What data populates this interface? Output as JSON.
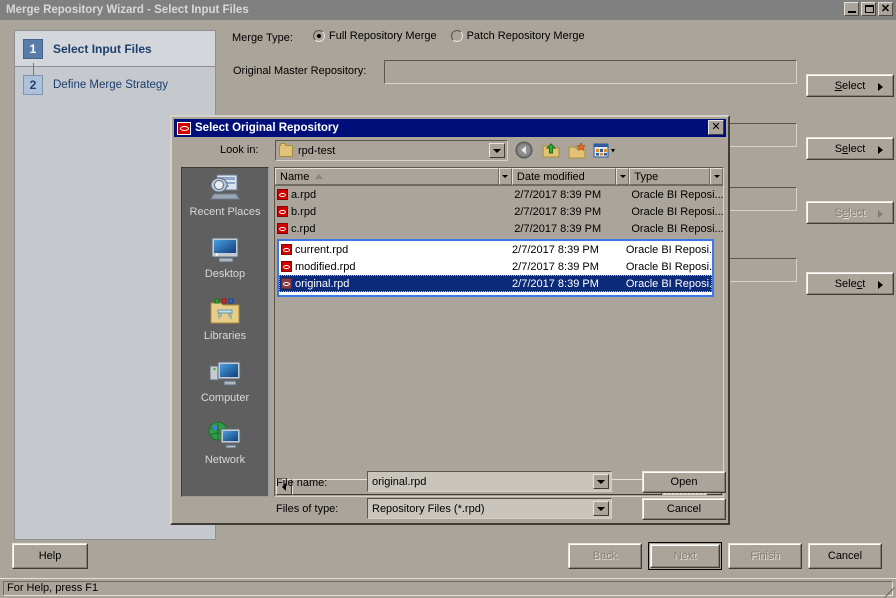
{
  "window": {
    "title": "Merge Repository Wizard - Select Input Files",
    "minimize_label": "Minimize",
    "maximize_label": "Maximize",
    "close_label": "✕"
  },
  "steps": [
    {
      "number": "1",
      "label": "Select Input Files"
    },
    {
      "number": "2",
      "label": "Define Merge Strategy"
    }
  ],
  "form": {
    "merge_type_label": "Merge Type:",
    "radio_full": "Full Repository Merge",
    "radio_patch": "Patch Repository Merge",
    "original_master_label": "Original Master Repository:",
    "original_master_value": "",
    "select_buttons": [
      {
        "prefix": "S",
        "mnemonic": "",
        "rest": "elect",
        "label": "Select",
        "mnemonic_char": "S",
        "disabled": false
      },
      {
        "label": "Select",
        "mnemonic_char": "e",
        "disabled": false
      },
      {
        "label": "Select",
        "mnemonic_char": "e",
        "disabled": true
      },
      {
        "label": "Select",
        "mnemonic_char": "c",
        "disabled": false
      }
    ]
  },
  "footer": {
    "help": "Help",
    "back": "Back",
    "next": "Next",
    "finish": "Finish",
    "cancel": "Cancel"
  },
  "statusbar": {
    "text": "For Help, press F1"
  },
  "dialog": {
    "title": "Select Original Repository",
    "close_label": "✕",
    "look_in_label": "Look in:",
    "look_in_value": "rpd-test",
    "toolbar": [
      {
        "name": "back-nav-icon",
        "title": "Back"
      },
      {
        "name": "up-one-level-icon",
        "title": "Up One Level"
      },
      {
        "name": "new-folder-icon",
        "title": "Create New Folder"
      },
      {
        "name": "views-icon",
        "title": "Views"
      }
    ],
    "places": [
      {
        "label": "Recent Places",
        "icon": "recent-places-icon"
      },
      {
        "label": "Desktop",
        "icon": "desktop-icon"
      },
      {
        "label": "Libraries",
        "icon": "libraries-icon"
      },
      {
        "label": "Computer",
        "icon": "computer-icon"
      },
      {
        "label": "Network",
        "icon": "network-icon"
      }
    ],
    "columns": [
      "Name",
      "Date modified",
      "Type"
    ],
    "sort": {
      "column": "Name",
      "direction": "ascending"
    },
    "files": [
      {
        "name": "a.rpd",
        "date": "2/7/2017 8:39 PM",
        "type": "Oracle BI Reposi...",
        "state": "normal"
      },
      {
        "name": "b.rpd",
        "date": "2/7/2017 8:39 PM",
        "type": "Oracle BI Reposi...",
        "state": "normal"
      },
      {
        "name": "c.rpd",
        "date": "2/7/2017 8:39 PM",
        "type": "Oracle BI Reposi...",
        "state": "normal"
      },
      {
        "name": "current.rpd",
        "date": "2/7/2017 8:39 PM",
        "type": "Oracle BI Reposi..",
        "state": "highlighted"
      },
      {
        "name": "modified.rpd",
        "date": "2/7/2017 8:39 PM",
        "type": "Oracle BI Reposi..",
        "state": "highlighted"
      },
      {
        "name": "original.rpd",
        "date": "2/7/2017 8:39 PM",
        "type": "Oracle BI Reposi..",
        "state": "selected"
      }
    ],
    "file_name_label": "File name:",
    "file_name_value": "original.rpd",
    "files_of_type_label": "Files of type:",
    "files_of_type_value": "Repository Files (*.rpd)",
    "open_button": "Open",
    "cancel_button": "Cancel"
  },
  "colors": {
    "face": "#aaa49a",
    "titlebar": "#808080",
    "dialog_titlebar": "#000e7a",
    "selection": "#0b2a7a",
    "highlight_border": "#3a78e8",
    "step_accent": "#5a7ca8",
    "oracle_red": "#cc0000"
  }
}
